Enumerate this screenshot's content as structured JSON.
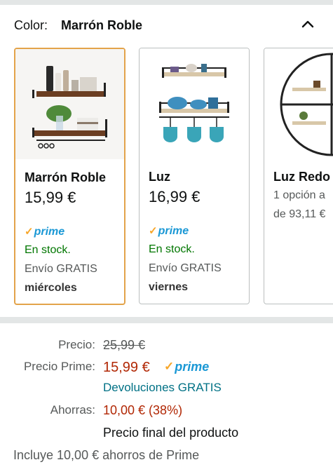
{
  "variation": {
    "label": "Color:",
    "selected": "Marrón Roble"
  },
  "cards": [
    {
      "name": "Marrón Roble",
      "price": "15,99 €",
      "prime": "prime",
      "stock": "En stock.",
      "shipping": "Envío GRATIS",
      "delivery_day": "miércoles",
      "selected": true
    },
    {
      "name": "Luz",
      "price": "16,99 €",
      "prime": "prime",
      "stock": "En stock.",
      "shipping": "Envío GRATIS",
      "delivery_day": "viernes",
      "selected": false
    },
    {
      "name": "Luz Redo",
      "options_line1": "1 opción a",
      "options_line2": "de 93,11 €",
      "selected": false
    }
  ],
  "pricing": {
    "list_label": "Precio:",
    "list_price": "25,99 €",
    "prime_label": "Precio Prime:",
    "prime_price": "15,99 €",
    "prime_word": "prime",
    "returns": "Devoluciones GRATIS",
    "savings_label": "Ahorras:",
    "savings_value": "10,00 € (38%)",
    "final_note": "Precio final del producto",
    "prime_savings_note": "Incluye 10,00 € ahorros de Prime"
  },
  "colors": {
    "selected_border": "#e3a34a",
    "prime_blue": "#1a98d5",
    "prime_check": "#f7a629",
    "stock_green": "#007600",
    "price_red": "#b12704",
    "link_teal": "#007185"
  }
}
